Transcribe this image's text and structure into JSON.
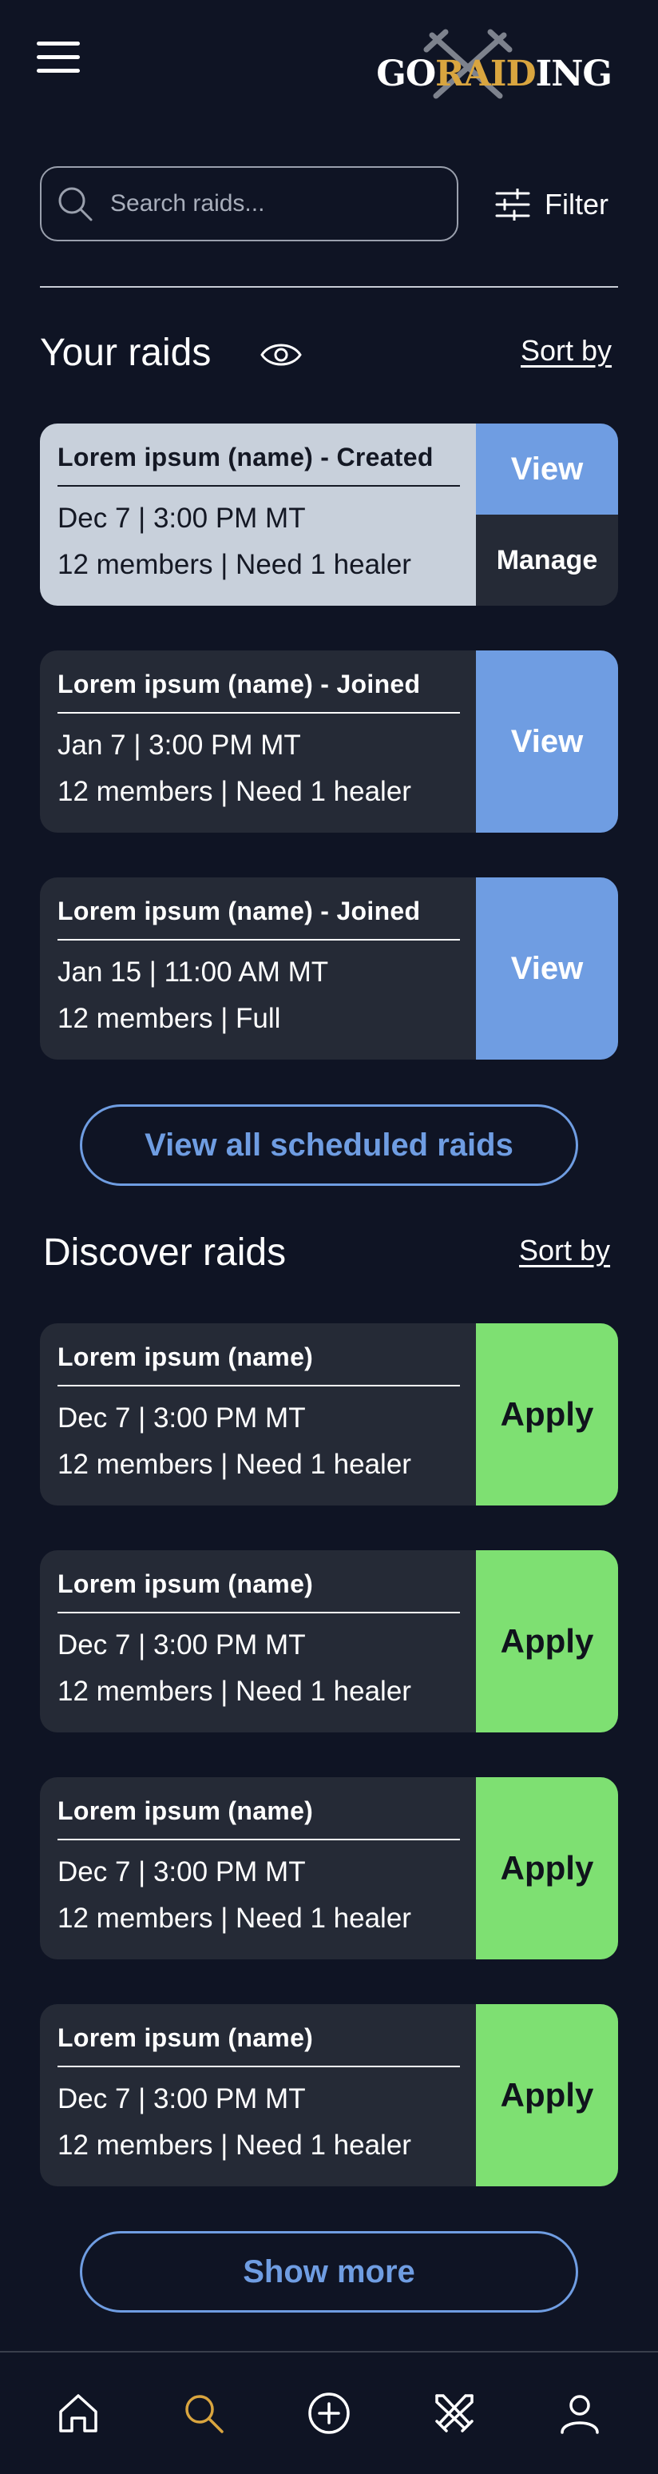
{
  "colors": {
    "background": "#0f1424",
    "card_dark": "#252a36",
    "card_light": "#c8d0db",
    "view_blue": "#6f9de2",
    "apply_green": "#7ee072",
    "logo_gold": "#d9a53f"
  },
  "header": {
    "menu_icon": "hamburger-icon",
    "logo": {
      "part1": "GO",
      "part2": "RAID",
      "part3": "ING",
      "emblem_icon": "crossed-swords-icon"
    }
  },
  "search": {
    "placeholder": "Search raids...",
    "value": "",
    "icon": "search-icon"
  },
  "filter": {
    "label": "Filter",
    "icon": "sliders-icon"
  },
  "your_raids": {
    "title": "Your raids",
    "visibility_icon": "eye-icon",
    "sort_label": "Sort by",
    "items": [
      {
        "name": "Lorem ipsum (name) - Created",
        "date": "Dec 7 | 3:00 PM MT",
        "meta": "12 members | Need 1 healer",
        "view_label": "View",
        "manage_label": "Manage"
      },
      {
        "name": "Lorem ipsum (name) - Joined",
        "date": "Jan 7 | 3:00 PM MT",
        "meta": "12 members | Need 1 healer",
        "view_label": "View"
      },
      {
        "name": "Lorem ipsum (name) - Joined",
        "date": "Jan 15 | 11:00 AM MT",
        "meta": "12 members | Full",
        "view_label": "View"
      }
    ],
    "view_all_label": "View all scheduled raids"
  },
  "discover_raids": {
    "title": "Discover raids",
    "sort_label": "Sort by",
    "items": [
      {
        "name": "Lorem ipsum (name)",
        "date": "Dec 7 | 3:00 PM MT",
        "meta": "12 members | Need 1 healer",
        "apply_label": "Apply"
      },
      {
        "name": "Lorem ipsum (name)",
        "date": "Dec 7 | 3:00 PM MT",
        "meta": "12 members | Need 1 healer",
        "apply_label": "Apply"
      },
      {
        "name": "Lorem ipsum (name)",
        "date": "Dec 7 | 3:00 PM MT",
        "meta": "12 members | Need 1 healer",
        "apply_label": "Apply"
      },
      {
        "name": "Lorem ipsum (name)",
        "date": "Dec 7 | 3:00 PM MT",
        "meta": "12 members | Need 1 healer",
        "apply_label": "Apply"
      }
    ],
    "show_more_label": "Show more"
  },
  "bottom_nav": {
    "items": [
      {
        "icon": "home-icon",
        "active": false
      },
      {
        "icon": "search-icon",
        "active": true
      },
      {
        "icon": "add-circle-icon",
        "active": false
      },
      {
        "icon": "crossed-swords-icon",
        "active": false
      },
      {
        "icon": "profile-icon",
        "active": false
      }
    ]
  }
}
